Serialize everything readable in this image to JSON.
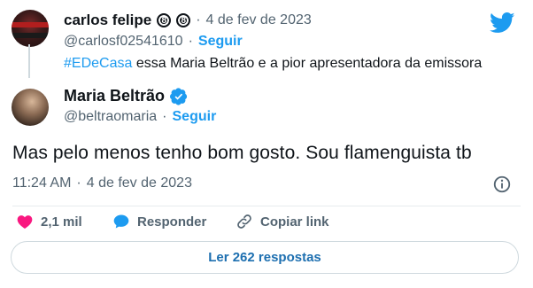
{
  "parent_tweet": {
    "author_name": "carlos felipe",
    "badges": [
      "8",
      "8"
    ],
    "separator": "·",
    "date": "4 de fev de 2023",
    "handle": "@carlosf02541610",
    "follow_label": "Seguir",
    "hashtag": "#EDeCasa",
    "text": " essa Maria Beltrão e a pior apresentadora da emissora"
  },
  "tweet": {
    "author_name": "Maria Beltrão",
    "handle": "@beltraomaria",
    "separator": "·",
    "follow_label": "Seguir",
    "text": "Mas pelo menos tenho bom gosto. Sou flamenguista tb",
    "time": "11:24 AM",
    "date": "4 de fev de 2023"
  },
  "actions": {
    "like_count": "2,1 mil",
    "reply_label": "Responder",
    "copy_label": "Copiar link"
  },
  "replies_button": "Ler 262 respostas",
  "icons": {
    "logo": "twitter-bird-icon",
    "verified": "verified-badge-icon",
    "info": "info-icon",
    "like": "heart-icon",
    "reply": "speech-bubble-icon",
    "copy": "link-icon"
  },
  "colors": {
    "accent": "#1d9bf0",
    "like": "#f91880",
    "muted": "#536471",
    "text": "#0f1419"
  }
}
